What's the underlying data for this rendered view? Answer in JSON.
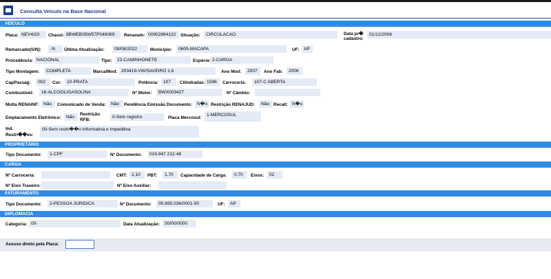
{
  "title": "Consulta Veículo na Base Nacional",
  "sections": {
    "veiculo": "VEÍCULO",
    "proprietario": "PROPRIETÁRIO",
    "carga": "CARGA",
    "faturamento": "FATURAMENTO",
    "diplomacia": "DIPLOMACIA"
  },
  "labels": {
    "placa": "Placa:",
    "chassi": "Chassi:",
    "renavam": "Renavam:",
    "situacao": "Situação:",
    "data_pre_l1": "Data pr�",
    "data_pre_l2": "cadastro:",
    "remarcado": "Remarcado(S/N):",
    "ultima_atualizacao": "Última Atualização:",
    "municipio": "Município:",
    "uf": "UF:",
    "procedencia": "Procedência:",
    "tipo": "Tipo:",
    "especie": "Espécie:",
    "tipo_montagem": "Tipo Montagem:",
    "marca_mod": "Marca/Mod:",
    "ano_mod": "Ano Mod:",
    "ano_fab": "Ano Fab:",
    "cap_passag": "CapPassag:",
    "cor": "Cor:",
    "potencia": "Potência:",
    "cilindradas": "Cilindradas:",
    "carroceria": "Carroceria:",
    "combustivel": "Combustível:",
    "n_motor": "Nº Motor:",
    "n_cambio": "Nº Câmbio:",
    "multa_renainf": "Multa RENAINF:",
    "comunicado_venda": "Comunicado de Venda:",
    "pendencia_emissao": "Pendência Emissão Documento:",
    "restricao_renajud": "Restrição RENAJUD:",
    "recall": "Recall:",
    "emplacamento": "Emplacamento Eletrônico:",
    "restricao_rfb_l1": "Restrição",
    "restricao_rfb_l2": "RFB:",
    "placa_mercosul": "Placa Mercosul:",
    "ind_restricoes_l1": "Ind.",
    "ind_restricoes_l2": "Restri��es:",
    "tipo_documento": "Tipo Documento:",
    "n_documento": "Nº Documento:",
    "n_carroceria": "Nº Carroceria:",
    "cmt": "CMT:",
    "pbt": "PBT:",
    "capacidade_carga": "Capacidade de Carga:",
    "eixos": "Eixos:",
    "n_eixo_traseiro": "Nº Eixo Traseiro:",
    "n_eixo_auxiliar": "Nº Eixo Auxiliar:",
    "fat_tipo_documento": "Tipo Documento:",
    "fat_n_documento": "Nº Documento:",
    "fat_uf": "UF:",
    "categoria": "Categoria:",
    "data_atualizacao": "Data Atualização:",
    "acesso_direto": "Acesso direto pela Placa:"
  },
  "values": {
    "placa": "NEV4I20",
    "chassi": "9BWEB05W57P046069",
    "renavam": "00902864122",
    "situacao": "CIRCULACAO",
    "data_pre_cadastro": "01/12/2006",
    "remarcado": "-N",
    "ultima_atualizacao": "09/08/2022",
    "municipio": "0605-MACAPA",
    "uf": "AP",
    "procedencia": "NACIONAL",
    "tipo": "23-CAMINHONETE",
    "especie": "2-CARGA",
    "tipo_montagem": "COMPLETA",
    "marca_mod": "203419-VW/SAVEIRO 1.6",
    "ano_mod": "2007",
    "ano_fab": "2006",
    "cap_passag": "002",
    "cor": "10-PRATA",
    "potencia": "107",
    "cilindradas": "1596",
    "carroceria": "107-C ABERTA",
    "combustivel": "16-ALCOOL/GASOLINA",
    "n_motor": "BWX003427",
    "n_cambio": "",
    "multa_renainf": "Não",
    "comunicado_venda": "Não",
    "pendencia_emissao": "N�o",
    "restricao_renajud": "Não",
    "recall": "N�o",
    "emplacamento": "Não",
    "restricao_rfb": "0-Sem registro",
    "placa_mercosul": "1-MERCOSUL",
    "ind_restricoes": "00-Sem restri��o Informativa e Impeditiva",
    "tipo_documento": "1-CPF",
    "n_documento": "016.947.212-48",
    "n_carroceria": "",
    "cmt": "2,10",
    "pbt": "1,70",
    "capacidade_carga": "0,70",
    "eixos": "02",
    "n_eixo_traseiro": "",
    "n_eixo_auxiliar": "",
    "fat_tipo_documento": "2-PESSOA JURIDICA",
    "fat_n_documento": "05.695.036/0001-50",
    "fat_uf": "AP",
    "categoria": "00-",
    "data_atualizacao": "00/00/0000",
    "acesso_direto": ""
  },
  "colors": {
    "section_bg": "#2f8be5",
    "value_bg": "#e4ebf6",
    "title_color": "#1f3f86"
  },
  "icons": {
    "app": "vehicle-query-icon"
  }
}
